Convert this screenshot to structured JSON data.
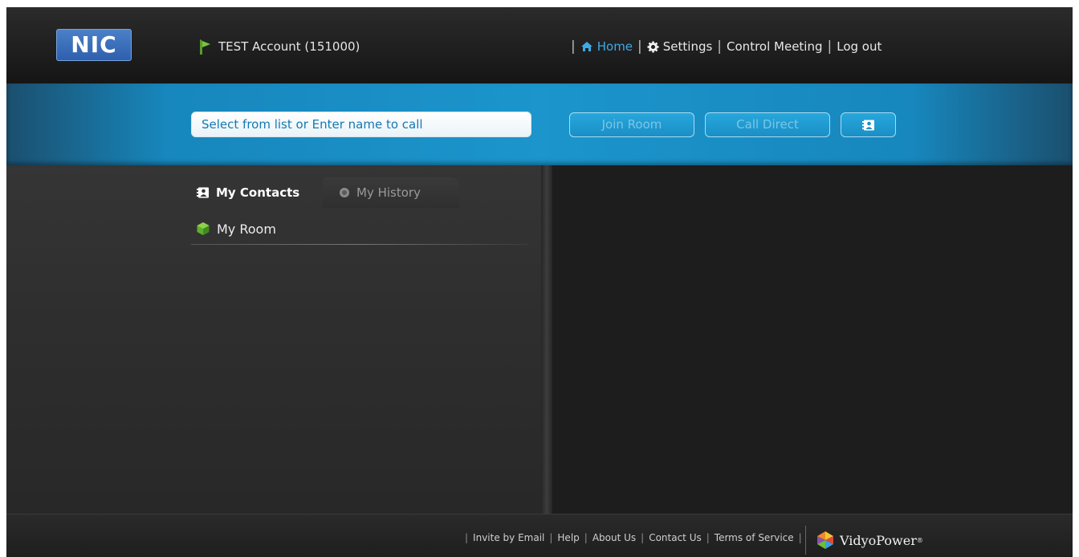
{
  "header": {
    "logo_text": "NIC",
    "account_label": "TEST Account (151000)",
    "nav": [
      {
        "label": "Home",
        "icon": "home-icon",
        "active": true
      },
      {
        "label": "Settings",
        "icon": "gear-icon",
        "active": false
      },
      {
        "label": "Control Meeting",
        "active": false
      },
      {
        "label": "Log out",
        "active": false
      }
    ]
  },
  "call_bar": {
    "search_placeholder": "Select from list or Enter name to call",
    "join_room_label": "Join Room",
    "call_direct_label": "Call Direct",
    "contacts_button_icon": "contact-card-icon"
  },
  "left_panel": {
    "tabs": [
      {
        "label": "My Contacts",
        "icon": "contact-card-icon",
        "active": true
      },
      {
        "label": "My History",
        "icon": "history-clock-icon",
        "active": false
      }
    ],
    "room_item": {
      "label": "My Room",
      "icon": "green-cube-icon"
    }
  },
  "footer": {
    "links": [
      "Invite by Email",
      "Help",
      "About Us",
      "Contact Us",
      "Terms of Service"
    ],
    "brand": "VidyoPower",
    "brand_mark": "®"
  },
  "colors": {
    "accent_blue": "#1b95cc",
    "active_nav": "#3fa9e6",
    "background": "#1c1c1c"
  }
}
